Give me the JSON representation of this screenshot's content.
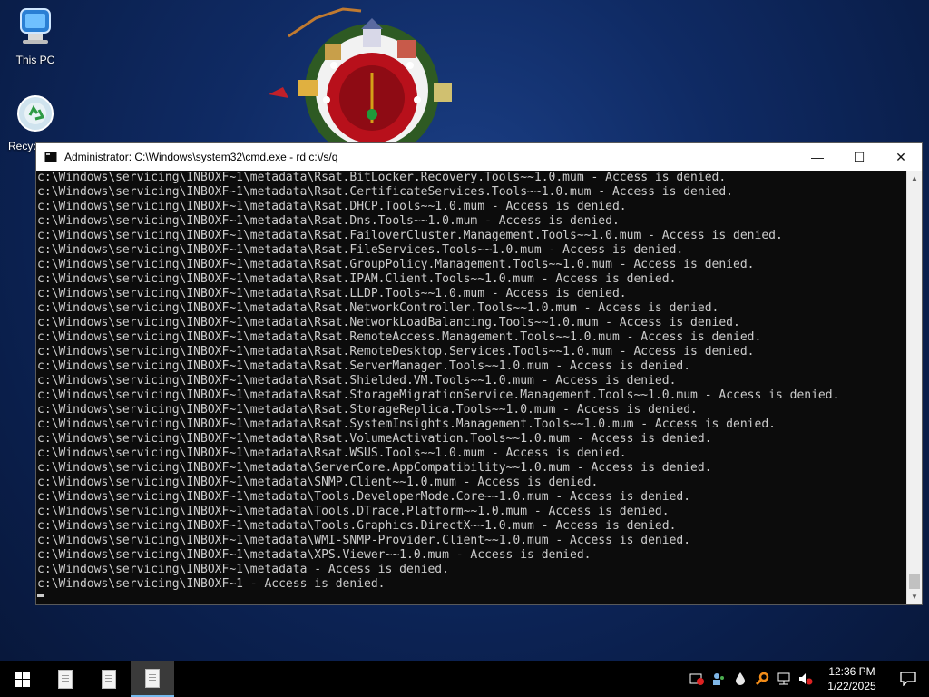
{
  "desktop": {
    "icons": [
      {
        "label": "This PC",
        "icon": "computer-icon"
      },
      {
        "label": "Recyc",
        "icon": "recycle-bin-icon"
      }
    ]
  },
  "cmd_window": {
    "title": "Administrator: C:\\Windows\\system32\\cmd.exe - rd  c:\\/s/q",
    "controls": {
      "minimize": "—",
      "maximize": "☐",
      "close": "✕"
    },
    "lines": [
      "c:\\Windows\\servicing\\INBOXF~1\\metadata\\Rsat.BitLocker.Recovery.Tools~~1.0.mum - Access is denied.",
      "c:\\Windows\\servicing\\INBOXF~1\\metadata\\Rsat.CertificateServices.Tools~~1.0.mum - Access is denied.",
      "c:\\Windows\\servicing\\INBOXF~1\\metadata\\Rsat.DHCP.Tools~~1.0.mum - Access is denied.",
      "c:\\Windows\\servicing\\INBOXF~1\\metadata\\Rsat.Dns.Tools~~1.0.mum - Access is denied.",
      "c:\\Windows\\servicing\\INBOXF~1\\metadata\\Rsat.FailoverCluster.Management.Tools~~1.0.mum - Access is denied.",
      "c:\\Windows\\servicing\\INBOXF~1\\metadata\\Rsat.FileServices.Tools~~1.0.mum - Access is denied.",
      "c:\\Windows\\servicing\\INBOXF~1\\metadata\\Rsat.GroupPolicy.Management.Tools~~1.0.mum - Access is denied.",
      "c:\\Windows\\servicing\\INBOXF~1\\metadata\\Rsat.IPAM.Client.Tools~~1.0.mum - Access is denied.",
      "c:\\Windows\\servicing\\INBOXF~1\\metadata\\Rsat.LLDP.Tools~~1.0.mum - Access is denied.",
      "c:\\Windows\\servicing\\INBOXF~1\\metadata\\Rsat.NetworkController.Tools~~1.0.mum - Access is denied.",
      "c:\\Windows\\servicing\\INBOXF~1\\metadata\\Rsat.NetworkLoadBalancing.Tools~~1.0.mum - Access is denied.",
      "c:\\Windows\\servicing\\INBOXF~1\\metadata\\Rsat.RemoteAccess.Management.Tools~~1.0.mum - Access is denied.",
      "c:\\Windows\\servicing\\INBOXF~1\\metadata\\Rsat.RemoteDesktop.Services.Tools~~1.0.mum - Access is denied.",
      "c:\\Windows\\servicing\\INBOXF~1\\metadata\\Rsat.ServerManager.Tools~~1.0.mum - Access is denied.",
      "c:\\Windows\\servicing\\INBOXF~1\\metadata\\Rsat.Shielded.VM.Tools~~1.0.mum - Access is denied.",
      "c:\\Windows\\servicing\\INBOXF~1\\metadata\\Rsat.StorageMigrationService.Management.Tools~~1.0.mum - Access is denied.",
      "c:\\Windows\\servicing\\INBOXF~1\\metadata\\Rsat.StorageReplica.Tools~~1.0.mum - Access is denied.",
      "c:\\Windows\\servicing\\INBOXF~1\\metadata\\Rsat.SystemInsights.Management.Tools~~1.0.mum - Access is denied.",
      "c:\\Windows\\servicing\\INBOXF~1\\metadata\\Rsat.VolumeActivation.Tools~~1.0.mum - Access is denied.",
      "c:\\Windows\\servicing\\INBOXF~1\\metadata\\Rsat.WSUS.Tools~~1.0.mum - Access is denied.",
      "c:\\Windows\\servicing\\INBOXF~1\\metadata\\ServerCore.AppCompatibility~~1.0.mum - Access is denied.",
      "c:\\Windows\\servicing\\INBOXF~1\\metadata\\SNMP.Client~~1.0.mum - Access is denied.",
      "c:\\Windows\\servicing\\INBOXF~1\\metadata\\Tools.DeveloperMode.Core~~1.0.mum - Access is denied.",
      "c:\\Windows\\servicing\\INBOXF~1\\metadata\\Tools.DTrace.Platform~~1.0.mum - Access is denied.",
      "c:\\Windows\\servicing\\INBOXF~1\\metadata\\Tools.Graphics.DirectX~~1.0.mum - Access is denied.",
      "c:\\Windows\\servicing\\INBOXF~1\\metadata\\WMI-SNMP-Provider.Client~~1.0.mum - Access is denied.",
      "c:\\Windows\\servicing\\INBOXF~1\\metadata\\XPS.Viewer~~1.0.mum - Access is denied.",
      "c:\\Windows\\servicing\\INBOXF~1\\metadata - Access is denied.",
      "c:\\Windows\\servicing\\INBOXF~1 - Access is denied."
    ]
  },
  "taskbar": {
    "start_icon": "windows-logo-icon",
    "apps": [
      {
        "icon": "notepad-icon",
        "active": false
      },
      {
        "icon": "notepad-icon",
        "active": false
      },
      {
        "icon": "notepad-icon",
        "active": true
      }
    ],
    "tray_icons": [
      "security-alert-icon",
      "network-people-icon",
      "water-drop-icon",
      "search-key-icon",
      "network-icon",
      "volume-muted-icon"
    ],
    "clock": {
      "time": "12:36 PM",
      "date": "1/22/2025"
    },
    "notification_icon": "action-center-icon"
  }
}
